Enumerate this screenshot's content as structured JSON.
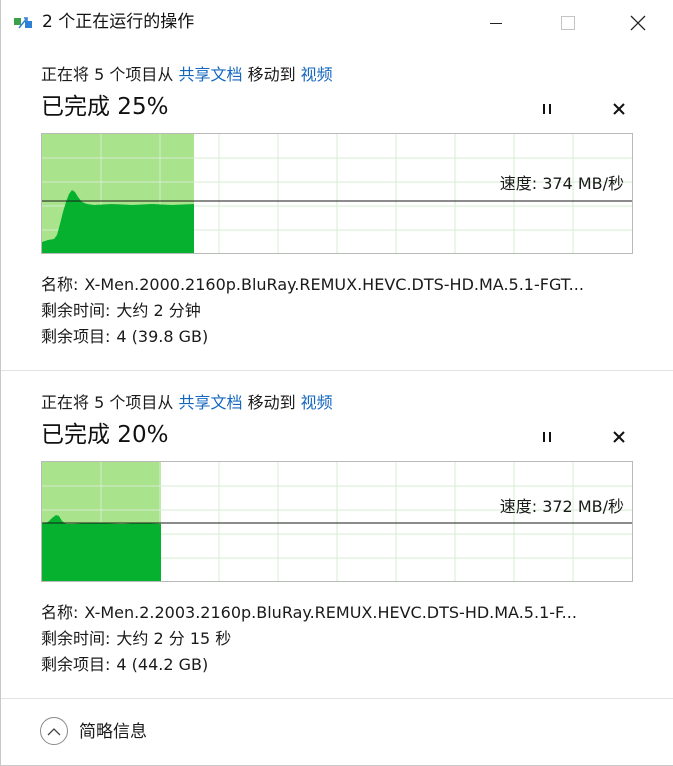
{
  "window": {
    "title": "2 个正在运行的操作",
    "icons": {
      "app": "file-move-icon",
      "minimize": "minimize-icon",
      "maximize": "maximize-icon",
      "close": "close-icon"
    }
  },
  "colors": {
    "link": "#1467c1",
    "graph_done": "#a9e38c",
    "graph_fill": "#06b12f",
    "grid": "#d5ecd1"
  },
  "operations": [
    {
      "desc_prefix": "正在将 5 个项目从",
      "source": "共享文档",
      "desc_middle": "移动到",
      "destination": "视频",
      "status": "已完成 25%",
      "percent": 25,
      "speed": "速度: 374 MB/秒",
      "name_label": "名称:",
      "name": "X-Men.2000.2160p.BluRay.REMUX.HEVC.DTS-HD.MA.5.1-FGT...",
      "time_label": "剩余时间:",
      "time": "大约 2 分钟",
      "items_label": "剩余项目:",
      "items": "4 (39.8 GB)"
    },
    {
      "desc_prefix": "正在将 5 个项目从",
      "source": "共享文档",
      "desc_middle": "移动到",
      "destination": "视频",
      "status": "已完成 20%",
      "percent": 20,
      "speed": "速度: 372 MB/秒",
      "name_label": "名称:",
      "name": "X-Men.2.2003.2160p.BluRay.REMUX.HEVC.DTS-HD.MA.5.1-F...",
      "time_label": "剩余时间:",
      "time": "大约 2 分 15 秒",
      "items_label": "剩余项目:",
      "items": "4 (44.2 GB)"
    }
  ],
  "footer": {
    "label": "简略信息",
    "icon": "chevron-up-icon"
  }
}
